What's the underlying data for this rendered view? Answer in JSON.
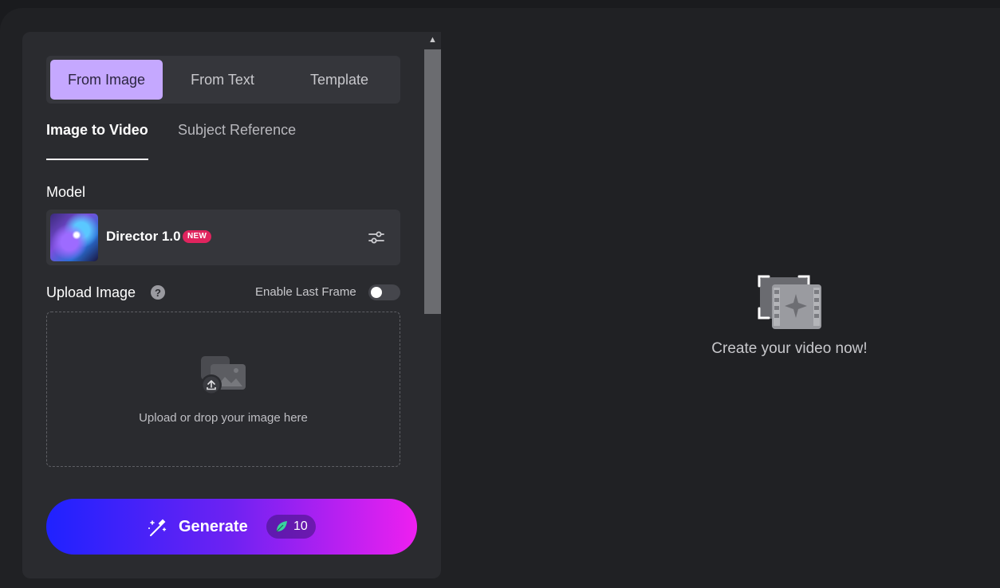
{
  "mode_tabs": [
    {
      "label": "From Image",
      "active": true
    },
    {
      "label": "From Text",
      "active": false
    },
    {
      "label": "Template",
      "active": false
    }
  ],
  "sub_tabs": [
    {
      "label": "Image to Video",
      "active": true
    },
    {
      "label": "Subject Reference",
      "active": false
    }
  ],
  "model": {
    "section_label": "Model",
    "name": "Director 1.0",
    "badge": "NEW"
  },
  "upload": {
    "section_label": "Upload Image",
    "help_glyph": "?",
    "toggle_label": "Enable Last Frame",
    "toggle_on": false,
    "drop_text": "Upload or drop your image here"
  },
  "generate": {
    "label": "Generate",
    "credits": "10"
  },
  "preview": {
    "empty_text": "Create your video now!"
  },
  "colors": {
    "accent_tab": "#c5a8ff",
    "badge": "#e0245e",
    "generate_gradient": [
      "#1f22ff",
      "#ee1ff0"
    ]
  },
  "icons": [
    "sliders-settings-icon",
    "help-icon",
    "image-upload-icon",
    "magic-wand-icon",
    "leaf-icon",
    "video-spark-icon",
    "scroll-up-icon"
  ]
}
